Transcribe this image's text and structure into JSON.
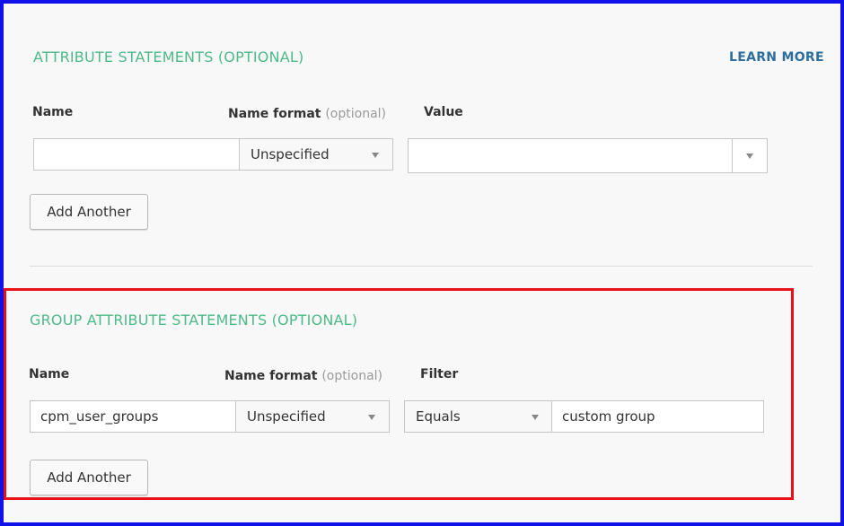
{
  "attribute_statements": {
    "title": "ATTRIBUTE STATEMENTS (OPTIONAL)",
    "learn_more": "LEARN MORE",
    "labels": {
      "name": "Name",
      "name_format": "Name format",
      "optional": "(optional)",
      "value": "Value"
    },
    "row": {
      "name_value": "",
      "name_format_selected": "Unspecified",
      "value": ""
    },
    "add_button": "Add Another"
  },
  "group_attribute_statements": {
    "title": "GROUP ATTRIBUTE STATEMENTS (OPTIONAL)",
    "labels": {
      "name": "Name",
      "name_format": "Name format",
      "optional": "(optional)",
      "filter": "Filter"
    },
    "row": {
      "name_value": "cpm_user_groups",
      "name_format_selected": "Unspecified",
      "filter_type_selected": "Equals",
      "filter_value": "custom group"
    },
    "add_button": "Add Another"
  },
  "colors": {
    "section_title": "#4fb98a",
    "link": "#2d6e9e",
    "outer_border": "#1010e8",
    "highlight_border": "#e8101a"
  },
  "icons": {
    "dropdown": "chevron-down-icon"
  }
}
